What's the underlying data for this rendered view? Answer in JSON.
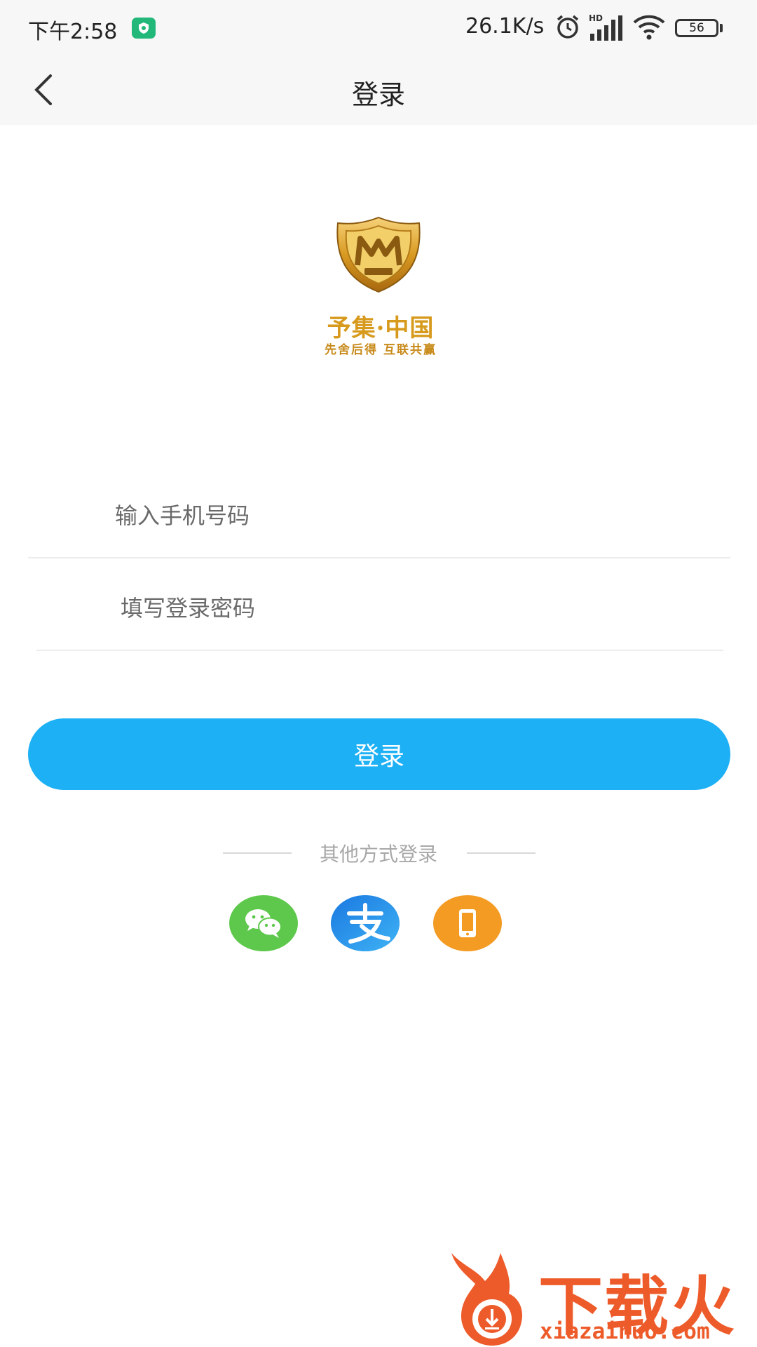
{
  "status_bar": {
    "time": "下午2:58",
    "net_speed": "26.1K/s",
    "signal_label": "HD",
    "battery_level": "56"
  },
  "nav": {
    "title": "登录"
  },
  "logo": {
    "line1": "予集·中国",
    "line2": "先舍后得 互联共赢"
  },
  "form": {
    "phone_placeholder": "输入手机号码",
    "phone_value": "",
    "password_placeholder": "填写登录密码",
    "password_value": ""
  },
  "login_button_label": "登录",
  "other_login": {
    "label": "其他方式登录",
    "methods": [
      "wechat-icon",
      "alipay-icon",
      "phone-icon"
    ]
  },
  "watermark": {
    "text": "下载火",
    "url": "xiazaihuo.com"
  },
  "colors": {
    "accent": "#1db0f5",
    "wechat": "#5dc84b",
    "alipay": "#1e8ce6",
    "phone": "#f49b24",
    "logo_gold": "#d79a1c",
    "watermark": "#ee5b2a"
  }
}
